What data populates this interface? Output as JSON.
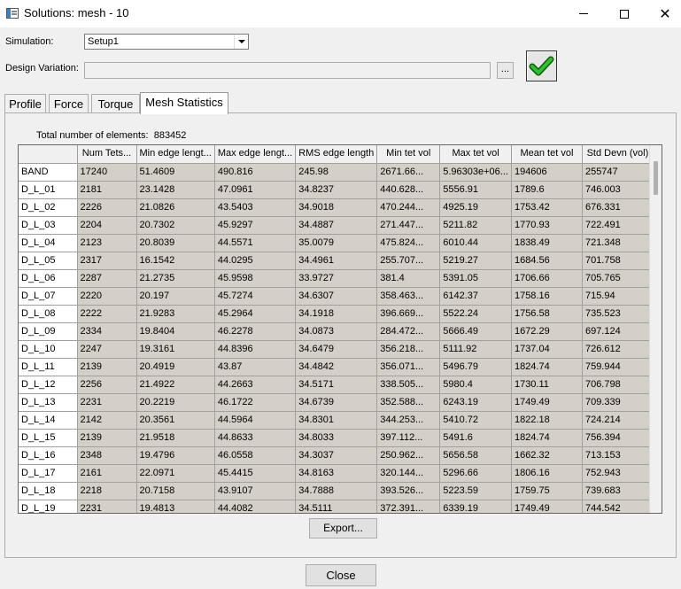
{
  "window": {
    "title": "Solutions: mesh - 10",
    "controls": {
      "minimize": "",
      "maximize": "",
      "close": "✕"
    }
  },
  "simulation": {
    "label": "Simulation:",
    "value": "Setup1"
  },
  "design_variation": {
    "label": "Design Variation:",
    "value": "",
    "browse_label": "..."
  },
  "tabs": [
    {
      "label": "Profile",
      "active": false
    },
    {
      "label": "Force",
      "active": false
    },
    {
      "label": "Torque",
      "active": false
    },
    {
      "label": "Mesh Statistics",
      "active": true
    }
  ],
  "stats": {
    "total_label": "Total number of elements:",
    "total_value": "883452"
  },
  "table": {
    "columns": [
      "Num Tets...",
      "Min edge lengt...",
      "Max edge lengt...",
      "RMS edge length",
      "Min tet vol",
      "Max tet vol",
      "Mean tet vol",
      "Std Devn (vol)"
    ],
    "rows": [
      {
        "name": "BAND",
        "values": [
          "17240",
          "51.4609",
          "490.816",
          "245.98",
          "2671.66...",
          "5.96303e+06...",
          "194606",
          "255747"
        ]
      },
      {
        "name": "D_L_01",
        "values": [
          "2181",
          "23.1428",
          "47.0961",
          "34.8237",
          "440.628...",
          "5556.91",
          "1789.6",
          "746.003"
        ]
      },
      {
        "name": "D_L_02",
        "values": [
          "2226",
          "21.0826",
          "43.5403",
          "34.9018",
          "470.244...",
          "4925.19",
          "1753.42",
          "676.331"
        ]
      },
      {
        "name": "D_L_03",
        "values": [
          "2204",
          "20.7302",
          "45.9297",
          "34.4887",
          "271.447...",
          "5211.82",
          "1770.93",
          "722.491"
        ]
      },
      {
        "name": "D_L_04",
        "values": [
          "2123",
          "20.8039",
          "44.5571",
          "35.0079",
          "475.824...",
          "6010.44",
          "1838.49",
          "721.348"
        ]
      },
      {
        "name": "D_L_05",
        "values": [
          "2317",
          "16.1542",
          "44.0295",
          "34.4961",
          "255.707...",
          "5219.27",
          "1684.56",
          "701.758"
        ]
      },
      {
        "name": "D_L_06",
        "values": [
          "2287",
          "21.2735",
          "45.9598",
          "33.9727",
          "381.4",
          "5391.05",
          "1706.66",
          "705.765"
        ]
      },
      {
        "name": "D_L_07",
        "values": [
          "2220",
          "20.197",
          "45.7274",
          "34.6307",
          "358.463...",
          "6142.37",
          "1758.16",
          "715.94"
        ]
      },
      {
        "name": "D_L_08",
        "values": [
          "2222",
          "21.9283",
          "45.2964",
          "34.1918",
          "396.669...",
          "5522.24",
          "1756.58",
          "735.523"
        ]
      },
      {
        "name": "D_L_09",
        "values": [
          "2334",
          "19.8404",
          "46.2278",
          "34.0873",
          "284.472...",
          "5666.49",
          "1672.29",
          "697.124"
        ]
      },
      {
        "name": "D_L_10",
        "values": [
          "2247",
          "19.3161",
          "44.8396",
          "34.6479",
          "356.218...",
          "5111.92",
          "1737.04",
          "726.612"
        ]
      },
      {
        "name": "D_L_11",
        "values": [
          "2139",
          "20.4919",
          "43.87",
          "34.4842",
          "356.071...",
          "5496.79",
          "1824.74",
          "759.944"
        ]
      },
      {
        "name": "D_L_12",
        "values": [
          "2256",
          "21.4922",
          "44.2663",
          "34.5171",
          "338.505...",
          "5980.4",
          "1730.11",
          "706.798"
        ]
      },
      {
        "name": "D_L_13",
        "values": [
          "2231",
          "20.2219",
          "46.1722",
          "34.6739",
          "352.588...",
          "6243.19",
          "1749.49",
          "709.339"
        ]
      },
      {
        "name": "D_L_14",
        "values": [
          "2142",
          "20.3561",
          "44.5964",
          "34.8301",
          "344.253...",
          "5410.72",
          "1822.18",
          "724.214"
        ]
      },
      {
        "name": "D_L_15",
        "values": [
          "2139",
          "21.9518",
          "44.8633",
          "34.8033",
          "397.112...",
          "5491.6",
          "1824.74",
          "756.394"
        ]
      },
      {
        "name": "D_L_16",
        "values": [
          "2348",
          "19.4796",
          "46.0558",
          "34.3037",
          "250.962...",
          "5656.58",
          "1662.32",
          "713.153"
        ]
      },
      {
        "name": "D_L_17",
        "values": [
          "2161",
          "22.0971",
          "45.4415",
          "34.8163",
          "320.144...",
          "5296.66",
          "1806.16",
          "752.943"
        ]
      },
      {
        "name": "D_L_18",
        "values": [
          "2218",
          "20.7158",
          "43.9107",
          "34.7888",
          "393.526...",
          "5223.59",
          "1759.75",
          "739.683"
        ]
      },
      {
        "name": "D_L_19",
        "values": [
          "2231",
          "19.4813",
          "44.4082",
          "34.5111",
          "372.391...",
          "6339.19",
          "1749.49",
          "744.542"
        ]
      }
    ]
  },
  "buttons": {
    "export": "Export...",
    "close": "Close"
  },
  "icons": {
    "apply": "green-checkmark-icon",
    "app": "window-app-icon"
  },
  "colors": {
    "check_green": "#1fa51f",
    "cell_background": "#d4d0c8"
  }
}
